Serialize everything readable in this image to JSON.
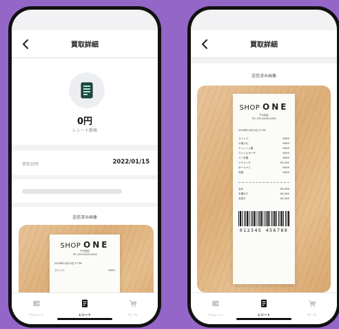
{
  "nav": {
    "title": "買取詳細"
  },
  "summary": {
    "amount": "0円",
    "caption": "レシート数格"
  },
  "detail": {
    "date_label": "買取日時",
    "date_value": "2022/01/15"
  },
  "images": {
    "caption": "送信済み画像"
  },
  "receipt": {
    "shop_prefix": "SHOP",
    "shop_name": "ONE",
    "address": "千代田区",
    "tel": "TEL XXX-XXXX-XXXX",
    "date": "2020年12月12日 17:36",
    "items": [
      {
        "name": "スリッパ",
        "price": "¥XXX"
      },
      {
        "name": "小物入れ",
        "price": "¥XXX"
      },
      {
        "name": "ティッシュ箱",
        "price": "¥XXX"
      },
      {
        "name": "ワンくんポーチ",
        "price": "¥XXX"
      },
      {
        "name": "ミニ手帳",
        "price": "¥XXX"
      },
      {
        "name": "イヤリング",
        "price": "¥X,XXX"
      },
      {
        "name": "ボールペン",
        "price": "¥XXX"
      },
      {
        "name": "花瓶",
        "price": "¥XXX"
      }
    ],
    "totals": [
      {
        "name": "合計",
        "price": "¥X,XXX"
      },
      {
        "name": "お預かり",
        "price": "¥X,XXX"
      },
      {
        "name": "お釣り",
        "price": "¥X,XXX"
      }
    ],
    "barcode": "012345 456789"
  },
  "tabs": [
    {
      "label": "ウォレット",
      "icon": "wallet-icon",
      "active": false
    },
    {
      "label": "レシート",
      "icon": "receipt-icon",
      "active": true
    },
    {
      "label": "セール",
      "icon": "cart-icon",
      "active": false
    }
  ],
  "colors": {
    "background": "#9466c8",
    "accent": "#111111"
  }
}
